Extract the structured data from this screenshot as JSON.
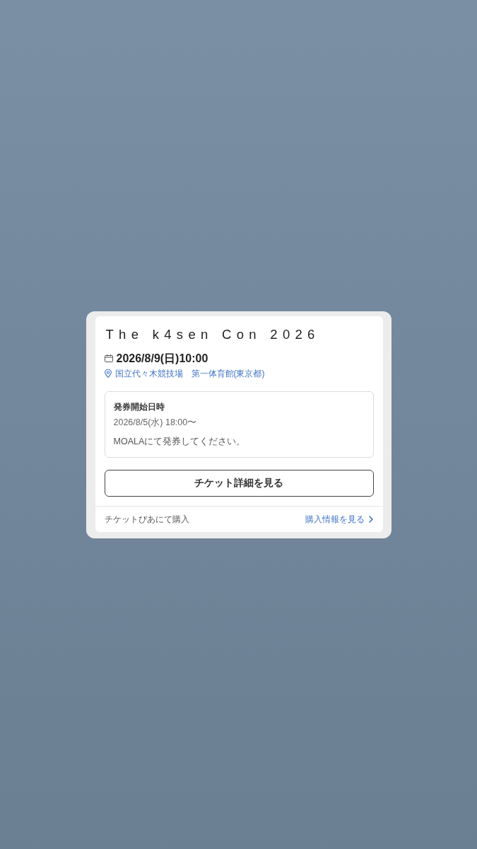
{
  "event": {
    "title": "The k4sen Con 2026",
    "datetime": "2026/8/9(日)10:00",
    "venue": "国立代々木競技場　第一体育館(東京都)"
  },
  "issue_info": {
    "label": "発券開始日時",
    "datetime": "2026/8/5(水) 18:00〜",
    "note": "MOALAにて発券してください。"
  },
  "detail_button": {
    "label": "チケット詳細を見る"
  },
  "footer": {
    "seller": "チケットぴあにて購入",
    "link": "購入情報を見る"
  }
}
